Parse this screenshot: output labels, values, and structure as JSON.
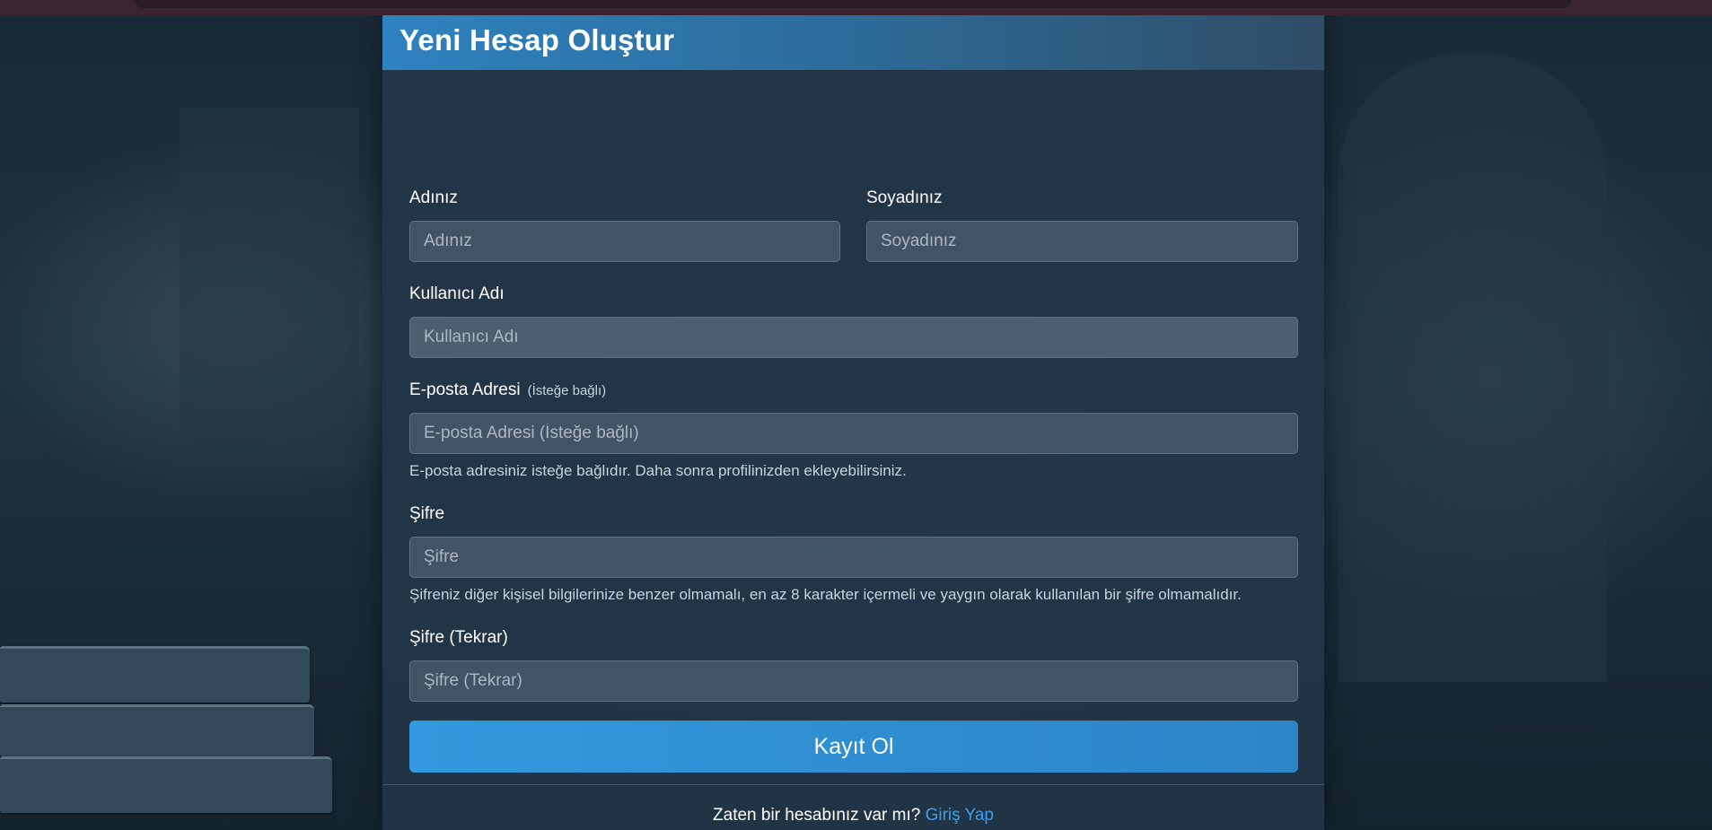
{
  "card": {
    "title": "Yeni Hesap Oluştur"
  },
  "form": {
    "first_name": {
      "label": "Adınız",
      "placeholder": "Adınız"
    },
    "last_name": {
      "label": "Soyadınız",
      "placeholder": "Soyadınız"
    },
    "username": {
      "label": "Kullanıcı Adı",
      "placeholder": "Kullanıcı Adı"
    },
    "email": {
      "label": "E-posta Adresi",
      "optional_tag": "(İsteğe bağlı)",
      "placeholder": "E-posta Adresi (İsteğe bağlı)",
      "help": "E-posta adresiniz isteğe bağlıdır. Daha sonra profilinizden ekleyebilirsiniz."
    },
    "password": {
      "label": "Şifre",
      "placeholder": "Şifre",
      "help": "Şifreniz diğer kişisel bilgilerinize benzer olmamalı, en az 8 karakter içermeli ve yaygın olarak kullanılan bir şifre olmamalıdır."
    },
    "password_confirm": {
      "label": "Şifre (Tekrar)",
      "placeholder": "Şifre (Tekrar)"
    },
    "submit_label": "Kayıt Ol"
  },
  "footer": {
    "text": "Zaten bir hesabınız var mı?",
    "link_label": "Giriş Yap"
  },
  "colors": {
    "accent": "#3398dd",
    "link": "#3aa0ec",
    "card_bg": "#223648"
  }
}
